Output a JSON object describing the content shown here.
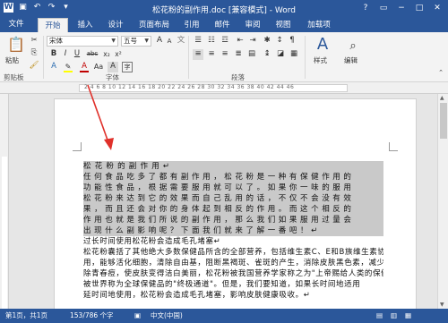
{
  "window": {
    "title": "松花粉的副作用.doc [兼容模式] - Word",
    "help": "?",
    "min": "−",
    "max": "□",
    "close": "✕"
  },
  "tabs": {
    "file": "文件",
    "items": [
      "开始",
      "插入",
      "设计",
      "页面布局",
      "引用",
      "邮件",
      "审阅",
      "视图",
      "加载项"
    ]
  },
  "ribbon": {
    "paste_label": "粘贴",
    "clipboard_label": "剪贴板",
    "font_name": "宋体",
    "font_size": "五号",
    "font_group_label": "字体",
    "paragraph_group_label": "段落",
    "styles_label": "样式",
    "editing_label": "编辑",
    "bold": "B",
    "italic": "I",
    "underline": "U",
    "strike": "abc",
    "sub": "x₂",
    "sup": "x²",
    "grow": "A",
    "shrink": "A",
    "clear": "A",
    "wen": "文",
    "colors": {
      "font_color": "#c00000",
      "highlight": "#ffff00"
    }
  },
  "ruler": {
    "numbers": "2  4  6  8  10  12  14  16  18  20  22  24  26  28  30  32  34  36  38  40  42  44  46"
  },
  "document": {
    "selected_lines": [
      "松花粉的副作用↵",
      "任何食品吃多了都有副作用，松花粉是一种有保健作用的",
      "功能性食品，根据需要服用就可以了。如果你一味的服用",
      "松花粉来达到它的效果而自己乱用的话，不仅不会没有效",
      "果，而且还会对你的身体起到相反的作用。而这个相反的",
      "作用也就是我们所说的副作用，那么我们如果服用过量会",
      "出现什么副影响呢？下面我们就来了解一番吧！↵"
    ],
    "plain_lines": [
      "过长时间使用松花粉会造成毛孔堵塞↵",
      "松花粉囊括了其他绝大多数保健品所含的全部营养，包括维生素C、E和B族维生素协调作",
      "用，能够活化细胞，清除自由基，阻断黑褐斑、雀斑的产生，消除皮肤黑色素，减少、去",
      "除青春痘，使皮肤变得洁白美丽，松花粉被我国营养学家称之为\"上帝赐给人类的保健珍品\"",
      "被世界称为全球保健品的\"终极通道\"。但是，我们要知道，如果长时间地适用",
      "延时间地使用，松花粉会造成毛孔堵塞，影响皮肤健康吸收。↵"
    ]
  },
  "status": {
    "page": "第1页，共1页",
    "words": "153/786 个字",
    "lang": "中文(中国)"
  }
}
